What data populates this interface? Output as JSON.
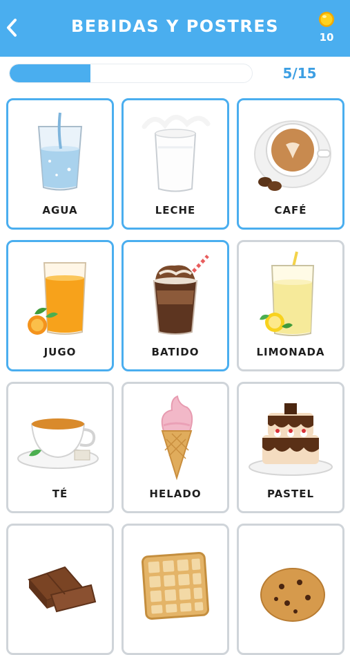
{
  "header": {
    "title": "BEBIDAS Y POSTRES",
    "coins": "10",
    "back_icon": "chevron-left-icon",
    "coin_icon": "coin-icon",
    "color": "#4aaeef"
  },
  "progress": {
    "text": "5/15",
    "current": 5,
    "total": 15,
    "fill_fraction": 0.333
  },
  "cards": [
    {
      "label": "AGUA",
      "icon": "water-glass-icon",
      "selected": true
    },
    {
      "label": "LECHE",
      "icon": "milk-glass-icon",
      "selected": true
    },
    {
      "label": "CAFÉ",
      "icon": "coffee-cup-icon",
      "selected": true
    },
    {
      "label": "JUGO",
      "icon": "orange-juice-icon",
      "selected": true
    },
    {
      "label": "BATIDO",
      "icon": "milkshake-icon",
      "selected": true
    },
    {
      "label": "LIMONADA",
      "icon": "lemonade-icon",
      "selected": false
    },
    {
      "label": "TÉ",
      "icon": "tea-cup-icon",
      "selected": false
    },
    {
      "label": "HELADO",
      "icon": "ice-cream-cone-icon",
      "selected": false
    },
    {
      "label": "PASTEL",
      "icon": "cake-icon",
      "selected": false
    },
    {
      "label": "",
      "icon": "chocolate-icon",
      "selected": false
    },
    {
      "label": "",
      "icon": "waffle-icon",
      "selected": false
    },
    {
      "label": "",
      "icon": "cookie-icon",
      "selected": false
    }
  ],
  "colors": {
    "accent": "#4aaeef",
    "selected_border": "#4aaeef",
    "unselected_border": "#cfd4d9"
  }
}
